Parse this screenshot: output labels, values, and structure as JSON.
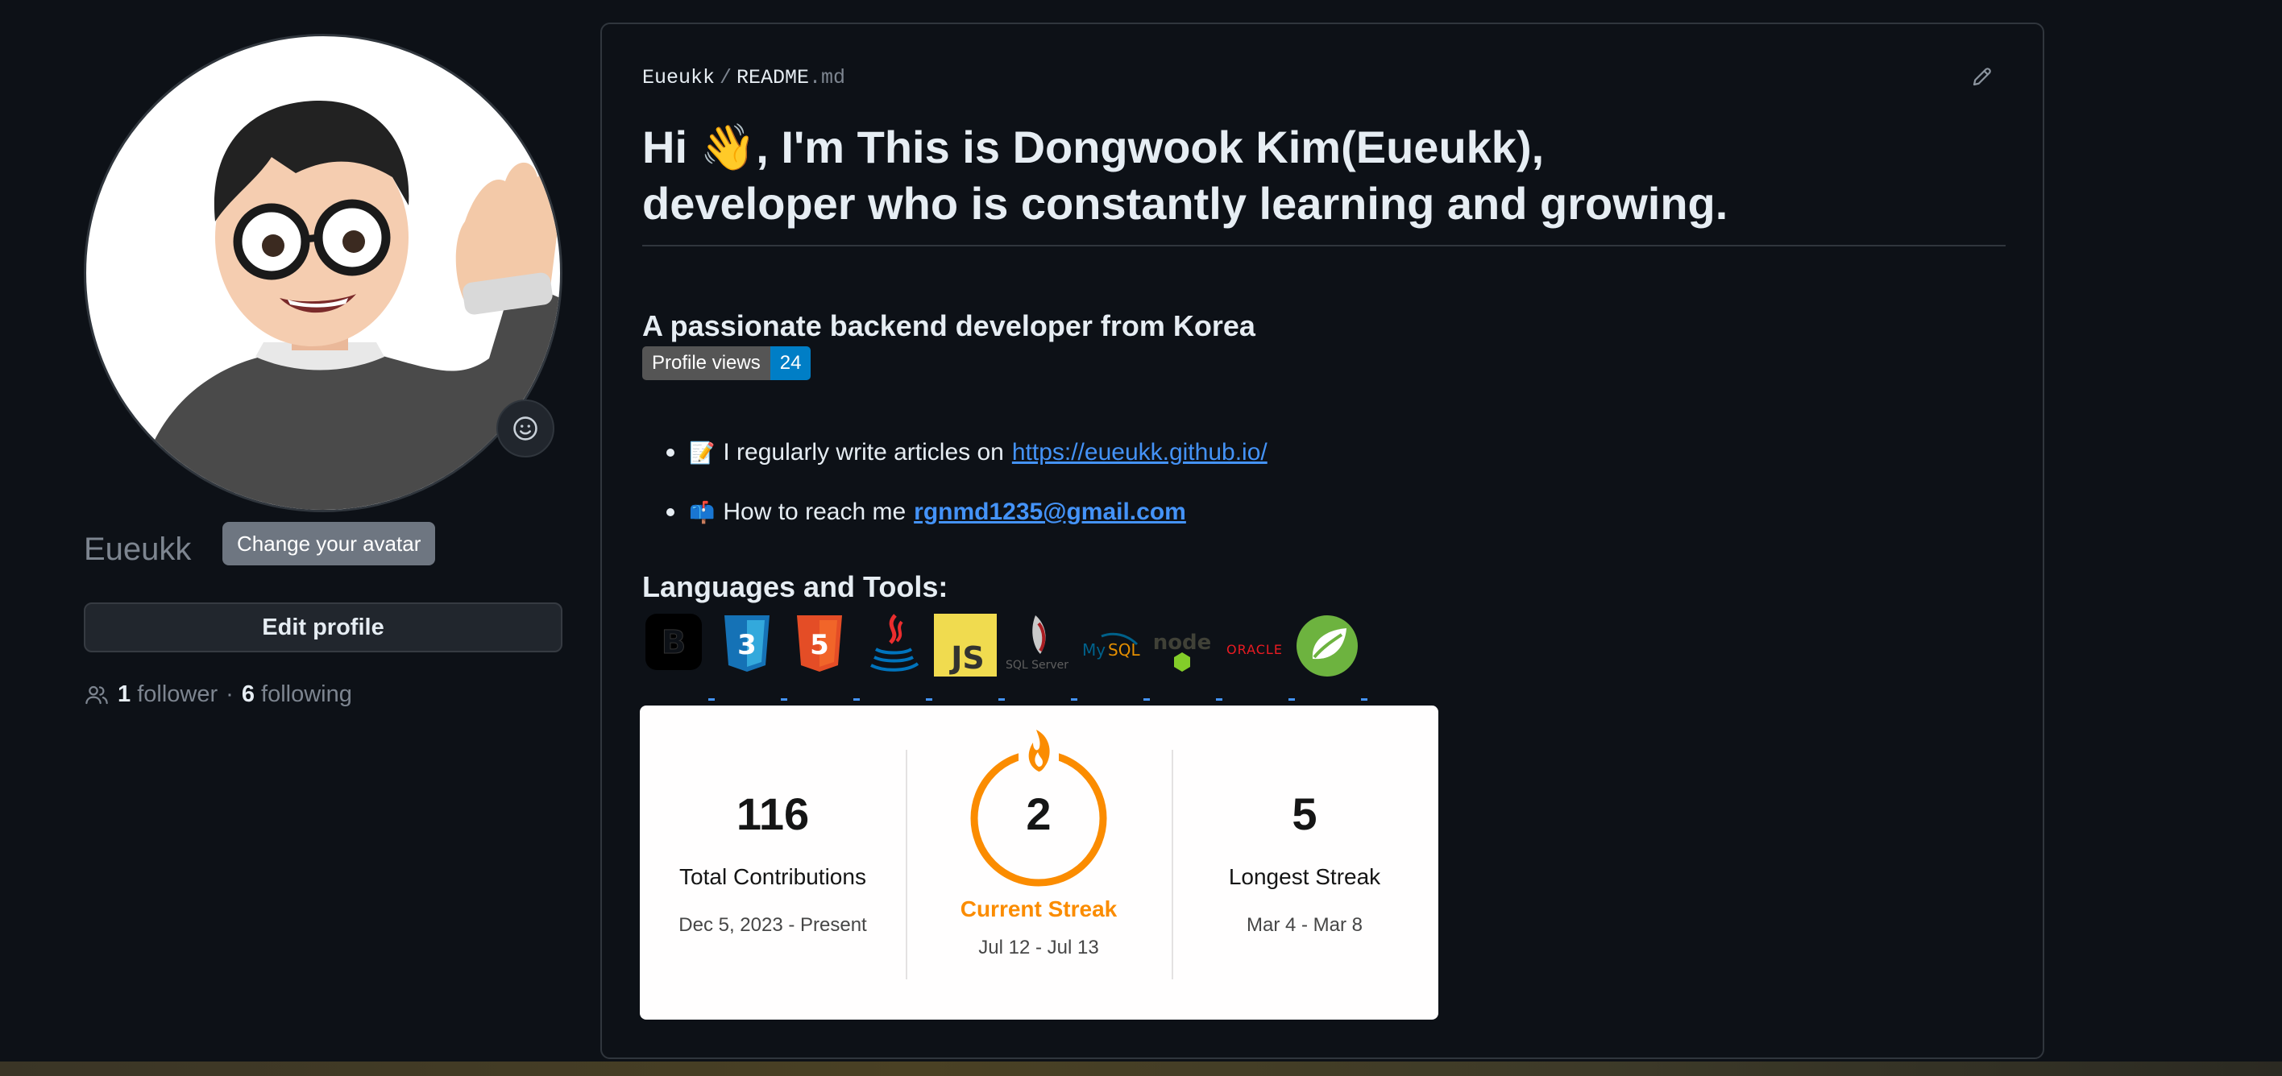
{
  "profile": {
    "username": "Eueukk",
    "tooltip": "Change your avatar",
    "edit_button": "Edit profile",
    "followers_count": "1",
    "followers_label": "follower",
    "separator": "·",
    "following_count": "6",
    "following_label": "following"
  },
  "readme": {
    "owner": "Eueukk",
    "separator": "/",
    "filename": "README",
    "extension": ".md",
    "heading_line1": "Hi 👋, I'm This is Dongwook Kim(Eueukk),",
    "heading_line2": "developer who is constantly learning and growing.",
    "subtitle": "A passionate backend developer from Korea",
    "badge_label": "Profile views",
    "badge_value": "24",
    "bullets": [
      {
        "emoji": "📝",
        "text": "I regularly write articles on",
        "link": "https://eueukk.github.io/"
      },
      {
        "emoji": "📫",
        "text": "How to reach me",
        "link": "rgnmd1235@gmail.com"
      }
    ],
    "tools_heading": "Languages and Tools:",
    "tools": [
      "bootstrap-icon",
      "css3-icon",
      "html5-icon",
      "java-icon",
      "javascript-icon",
      "mssql-icon",
      "mysql-icon",
      "nodejs-icon",
      "oracle-icon",
      "spring-icon"
    ]
  },
  "streak": {
    "total_value": "116",
    "total_label": "Total Contributions",
    "total_range": "Dec 5, 2023 - Present",
    "current_value": "2",
    "current_label": "Current Streak",
    "current_range": "Jul 12 - Jul 13",
    "longest_value": "5",
    "longest_label": "Longest Streak",
    "longest_range": "Mar 4 - Mar 8"
  },
  "colors": {
    "background": "#0d1117",
    "link": "#4493f8",
    "streak_accent": "#fb8c00",
    "badge_value_bg": "#007ec6"
  }
}
